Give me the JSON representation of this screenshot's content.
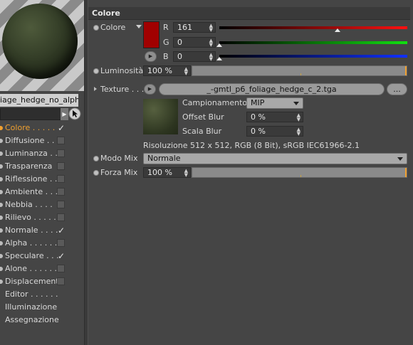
{
  "material": {
    "name": "iage_hedge_no_alpha"
  },
  "channels": [
    {
      "label": "Colore . . . . .",
      "checked": true,
      "active": true
    },
    {
      "label": "Diffusione . .",
      "checked": false
    },
    {
      "label": "Luminanza . .",
      "checked": false
    },
    {
      "label": "Trasparenza",
      "checked": false
    },
    {
      "label": "Riflessione . .",
      "checked": false
    },
    {
      "label": "Ambiente . . .",
      "checked": false
    },
    {
      "label": "Nebbia . . . .",
      "checked": false
    },
    {
      "label": "Rilievo . . . . .",
      "checked": false
    },
    {
      "label": "Normale . . . .",
      "checked": true
    },
    {
      "label": "Alpha . . . . . .",
      "checked": false
    },
    {
      "label": "Speculare . . .",
      "checked": true
    },
    {
      "label": "Alone . . . . . .",
      "checked": false
    },
    {
      "label": "Displacement",
      "checked": false
    }
  ],
  "extra_items": [
    "Editor . . . . . .",
    "Illuminazione",
    "Assegnazione"
  ],
  "panel": {
    "title": "Colore",
    "color_label": "Colore",
    "r_label": "R",
    "r_value": "161",
    "g_label": "G",
    "g_value": "0",
    "b_label": "B",
    "b_value": "0",
    "r_level": 0.63,
    "g_level": 0.0,
    "b_level": 0.0,
    "swatch_color": "#a10000",
    "lum_label": "Luminosità",
    "lum_value": "100 %",
    "texture_label": "Texture . . .",
    "texture_file": "_-gmtl_p6_foliage_hedge_c_2.tga",
    "texture_more": "...",
    "sampling_label": "Campionamento",
    "sampling_value": "MIP",
    "offset_label": "Offset Blur",
    "offset_value": "0 %",
    "scale_label": "Scala Blur",
    "scale_value": "0 %",
    "resolution": "Risoluzione 512 x 512, RGB (8 Bit), sRGB IEC61966-2.1",
    "mix_mode_label": "Modo Mix",
    "mix_mode_value": "Normale",
    "mix_strength_label": "Forza Mix",
    "mix_strength_value": "100 %"
  }
}
